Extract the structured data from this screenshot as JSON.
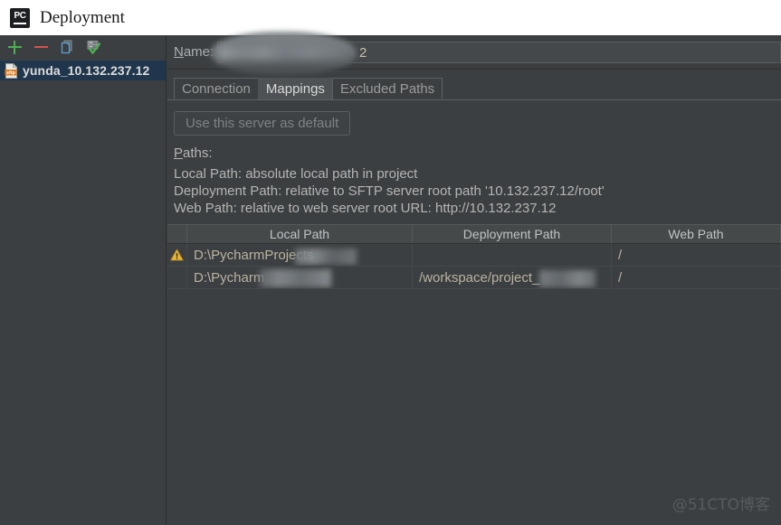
{
  "window": {
    "title": "Deployment",
    "app_icon": "pycharm-pc-icon",
    "icon_text": "PC"
  },
  "sidebar": {
    "toolbar": [
      {
        "name": "add-server-button",
        "icon": "plus-icon",
        "tooltip": "Add"
      },
      {
        "name": "remove-server-button",
        "icon": "minus-icon",
        "tooltip": "Remove"
      },
      {
        "name": "copy-server-button",
        "icon": "copy-icon",
        "tooltip": "Copy"
      },
      {
        "name": "set-default-server-button",
        "icon": "server-check-icon",
        "tooltip": "Use as default"
      }
    ],
    "servers": [
      {
        "label": "yunda_10.132.237.12",
        "icon": "sftp-icon",
        "selected": true
      }
    ]
  },
  "main": {
    "name_label": "Name:",
    "name_label_mnemonic": "N",
    "name_value_visible_tail": "2",
    "name_value_redacted": true,
    "tabs": [
      {
        "label": "Connection",
        "active": false
      },
      {
        "label": "Mappings",
        "active": true
      },
      {
        "label": "Excluded Paths",
        "active": false
      }
    ],
    "default_server_button": {
      "label": "Use this server as default",
      "enabled": false
    },
    "paths_section": {
      "label": "Paths:",
      "label_mnemonic": "P",
      "lines": [
        "Local Path: absolute local path in project",
        "Deployment Path: relative to SFTP server root path '10.132.237.12/root'",
        "Web Path: relative to web server root URL: http://10.132.237.12"
      ]
    },
    "table": {
      "columns": [
        "",
        "Local Path",
        "Deployment Path",
        "Web Path"
      ],
      "rows": [
        {
          "warning": true,
          "warning_icon": "warning-triangle-icon",
          "local_path": "D:\\PycharmProjects",
          "local_path_redacted": true,
          "deployment_path": "",
          "web_path": "/"
        },
        {
          "warning": false,
          "warning_icon": "",
          "local_path": "D:\\Pycharm",
          "local_path_redacted": true,
          "deployment_path": "/workspace/project_",
          "deployment_path_redacted": true,
          "web_path": "/"
        }
      ]
    }
  },
  "watermark": {
    "text": "@51CTO博客"
  },
  "colors": {
    "titlebar_bg": "#ffffff",
    "panel_bg": "#3c3f41",
    "table_header_bg": "#45494a",
    "selection_bg": "#20364c",
    "text": "#b4b4b4",
    "value_text": "#b9b3a0",
    "accent_green": "#4caf50",
    "accent_red": "#d3544a",
    "warning_yellow": "#e8b53a"
  }
}
